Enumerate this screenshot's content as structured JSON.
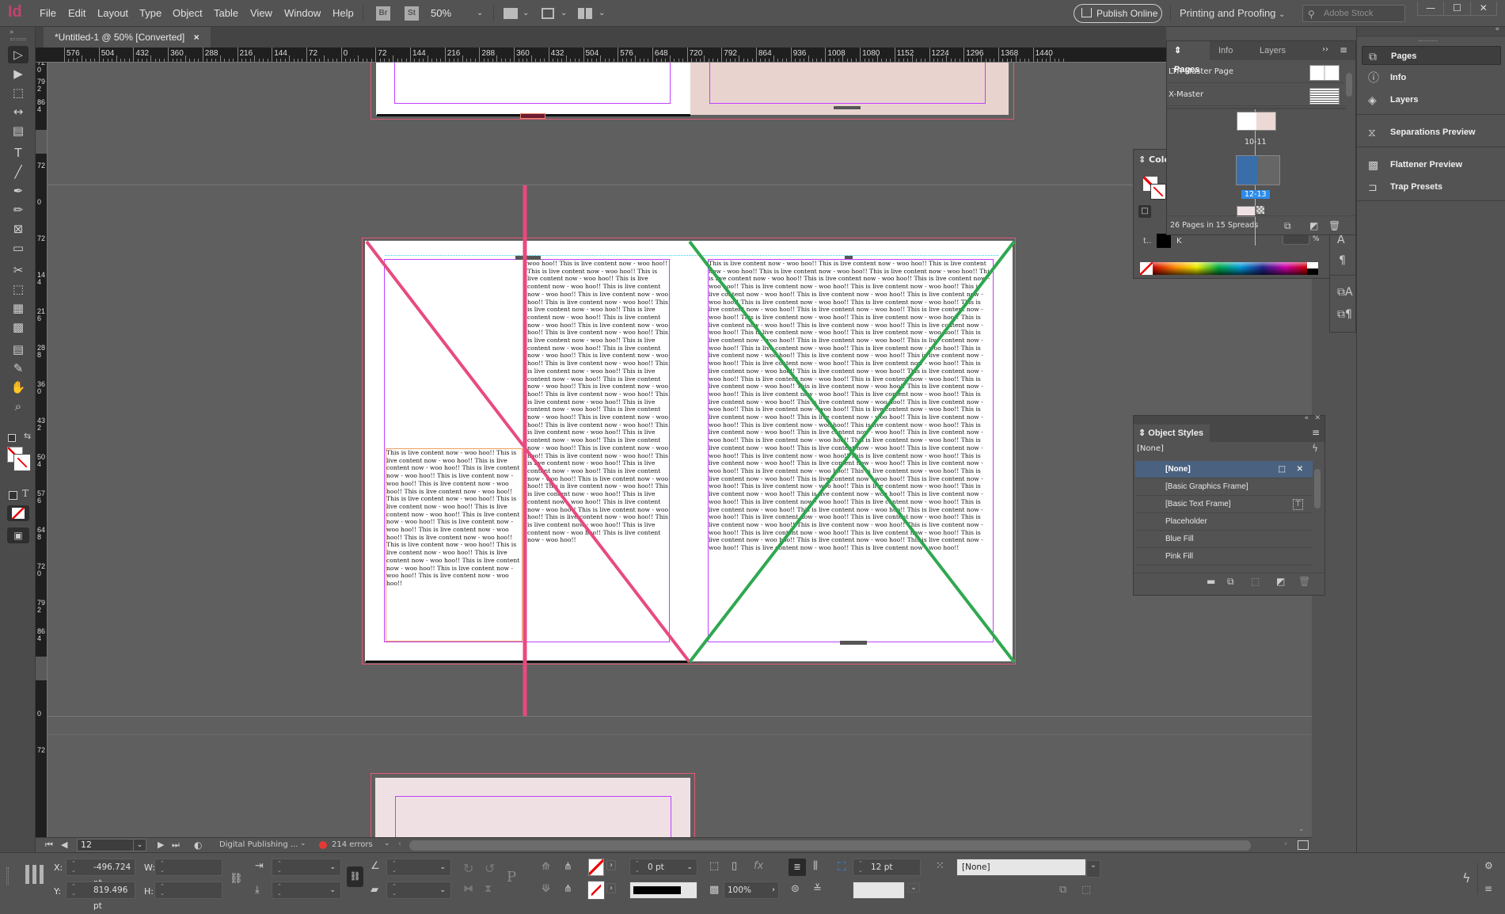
{
  "app": {
    "logo": "Id",
    "menu": [
      "File",
      "Edit",
      "Layout",
      "Type",
      "Object",
      "Table",
      "View",
      "Window",
      "Help"
    ],
    "bridge_badge": "Br",
    "stock_badge": "St",
    "zoom_level": "50%",
    "publish_online": "Publish Online",
    "workspace": "Printing and Proofing",
    "stock_search_placeholder": "Adobe Stock",
    "window_controls": {
      "minimize": "—",
      "maximize": "☐",
      "close": "✕"
    }
  },
  "document_tab": {
    "title": "*Untitled-1 @ 50% [Converted]",
    "close": "×"
  },
  "rulers": {
    "horizontal": [
      "576",
      "504",
      "432",
      "360",
      "288",
      "216",
      "144",
      "72",
      "0",
      "72",
      "144",
      "216",
      "288",
      "360",
      "432",
      "504",
      "576",
      "648",
      "720",
      "792",
      "864",
      "936",
      "1008",
      "1080",
      "1152",
      "1224",
      "1296",
      "1368",
      "1440"
    ],
    "vertical": [
      "720",
      "792",
      "864",
      "4",
      "72",
      "0",
      "72",
      "144",
      "216",
      "288",
      "360",
      "432",
      "504",
      "576",
      "648",
      "720",
      "792",
      "864",
      "72",
      "0",
      "72"
    ]
  },
  "tools": [
    {
      "name": "selection-tool",
      "glyph": "▷"
    },
    {
      "name": "direct-selection-tool",
      "glyph": "▶"
    },
    {
      "name": "page-tool",
      "glyph": "⬚"
    },
    {
      "name": "gap-tool",
      "glyph": "↔"
    },
    {
      "name": "content-collector-tool",
      "glyph": "▤"
    },
    {
      "name": "type-tool",
      "glyph": "T"
    },
    {
      "name": "line-tool",
      "glyph": "╱"
    },
    {
      "name": "pen-tool",
      "glyph": "✒"
    },
    {
      "name": "pencil-tool",
      "glyph": "✏"
    },
    {
      "name": "rectangle-frame-tool",
      "glyph": "⊠"
    },
    {
      "name": "rectangle-tool",
      "glyph": "▭"
    },
    {
      "name": "scissors-tool",
      "glyph": "✂"
    },
    {
      "name": "free-transform-tool",
      "glyph": "⬚"
    },
    {
      "name": "gradient-swatch-tool",
      "glyph": "▦"
    },
    {
      "name": "gradient-feather-tool",
      "glyph": "▩"
    },
    {
      "name": "note-tool",
      "glyph": "▤"
    },
    {
      "name": "eyedropper-tool",
      "glyph": "✎"
    },
    {
      "name": "hand-tool",
      "glyph": "✋"
    },
    {
      "name": "zoom-tool",
      "glyph": "⌕"
    }
  ],
  "canvas": {
    "sample_text": "This is live content now - woo hoo!! ",
    "left_top_text_start": "woo hoo!! ",
    "colors": {
      "bleed": "#e35a76",
      "margin": "#c040ff",
      "pink_diagonal": "#e84a7f",
      "green_diagonal": "#2fa84f",
      "guide": "#e84a7f"
    }
  },
  "navigation": {
    "page_number": "12",
    "preflight_profile": "Digital Publishing ...",
    "error_count": "214 errors",
    "error_color": "#e53935"
  },
  "control_panel": {
    "x_label": "X:",
    "x_value": "-496.724 pt",
    "y_label": "Y:",
    "y_value": "819.496 pt",
    "w_label": "W:",
    "w_value": "",
    "h_label": "H:",
    "h_value": "",
    "stroke_weight": "0 pt",
    "opacity": "100%",
    "auto_fit_value": "12 pt",
    "object_style": "[None]"
  },
  "pages_panel": {
    "tabs": [
      "Pages",
      "Info",
      "Layers"
    ],
    "masters": [
      "LTR-Master Page",
      "X-Master"
    ],
    "spreads": [
      {
        "label": "10-11",
        "selected": false
      },
      {
        "label": "12-13",
        "selected": true
      }
    ],
    "footer": "26 Pages in 15 Spreads"
  },
  "color_panel": {
    "title": "Colo",
    "k_label": "K",
    "percent": "%"
  },
  "dock": {
    "items": [
      {
        "label": "Pages",
        "icon": "pages-icon",
        "active": true
      },
      {
        "label": "Info",
        "icon": "info-icon",
        "active": false
      },
      {
        "label": "Layers",
        "icon": "layers-icon",
        "active": false
      },
      {
        "label": "Separations Preview",
        "icon": "separations-icon",
        "active": false
      },
      {
        "label": "Flattener Preview",
        "icon": "flattener-icon",
        "active": false
      },
      {
        "label": "Trap Presets",
        "icon": "trap-icon",
        "active": false
      }
    ]
  },
  "object_styles_panel": {
    "title": "Object Styles",
    "current": "[None]",
    "items": [
      {
        "label": "[None]",
        "selected": true
      },
      {
        "label": "[Basic Graphics Frame]",
        "selected": false
      },
      {
        "label": "[Basic Text Frame]",
        "selected": false
      },
      {
        "label": "Placeholder",
        "selected": false
      },
      {
        "label": "Blue Fill",
        "selected": false
      },
      {
        "label": "Pink Fill",
        "selected": false
      }
    ]
  }
}
